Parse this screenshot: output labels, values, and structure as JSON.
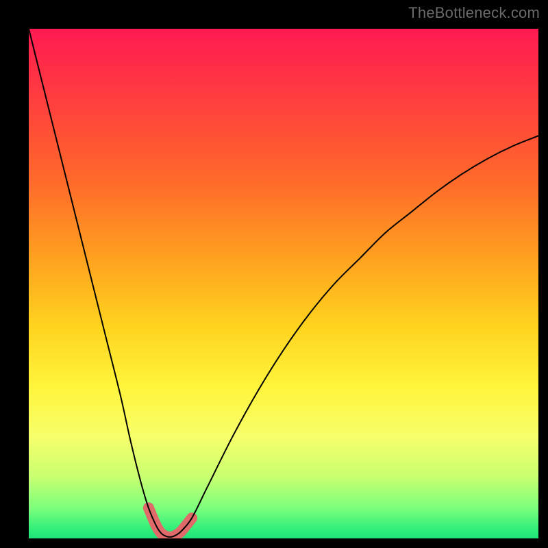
{
  "attribution": "TheBottleneck.com",
  "chart_data": {
    "type": "line",
    "title": "",
    "xlabel": "",
    "ylabel": "",
    "xlim": [
      0,
      100
    ],
    "ylim": [
      0,
      100
    ],
    "series": [
      {
        "name": "bottleneck-curve",
        "x": [
          0,
          3,
          6,
          9,
          12,
          15,
          18,
          20,
          22,
          23.5,
          25,
          26,
          27,
          28,
          29,
          30,
          32,
          35,
          40,
          45,
          50,
          55,
          60,
          65,
          70,
          75,
          80,
          85,
          90,
          95,
          100
        ],
        "values": [
          100,
          88,
          76,
          64,
          52,
          40,
          28,
          19,
          11,
          6,
          2.5,
          1,
          0.4,
          0.3,
          0.7,
          1.5,
          4,
          10,
          20,
          29,
          37,
          44,
          50,
          55,
          60,
          64,
          68,
          71.5,
          74.5,
          77,
          79
        ]
      }
    ],
    "valley_highlight": {
      "x_start": 22.5,
      "x_end": 32,
      "color": "#e06a6a"
    },
    "gradient_stops": [
      {
        "pct": 0,
        "color": "#ff1a52"
      },
      {
        "pct": 14,
        "color": "#ff3e3e"
      },
      {
        "pct": 30,
        "color": "#ff6a2a"
      },
      {
        "pct": 45,
        "color": "#ffa11f"
      },
      {
        "pct": 58,
        "color": "#ffd21e"
      },
      {
        "pct": 70,
        "color": "#fff43a"
      },
      {
        "pct": 80,
        "color": "#f7ff6a"
      },
      {
        "pct": 88,
        "color": "#c8ff70"
      },
      {
        "pct": 94,
        "color": "#7dff7d"
      },
      {
        "pct": 98,
        "color": "#33f07a"
      },
      {
        "pct": 100,
        "color": "#1ee27a"
      }
    ]
  }
}
